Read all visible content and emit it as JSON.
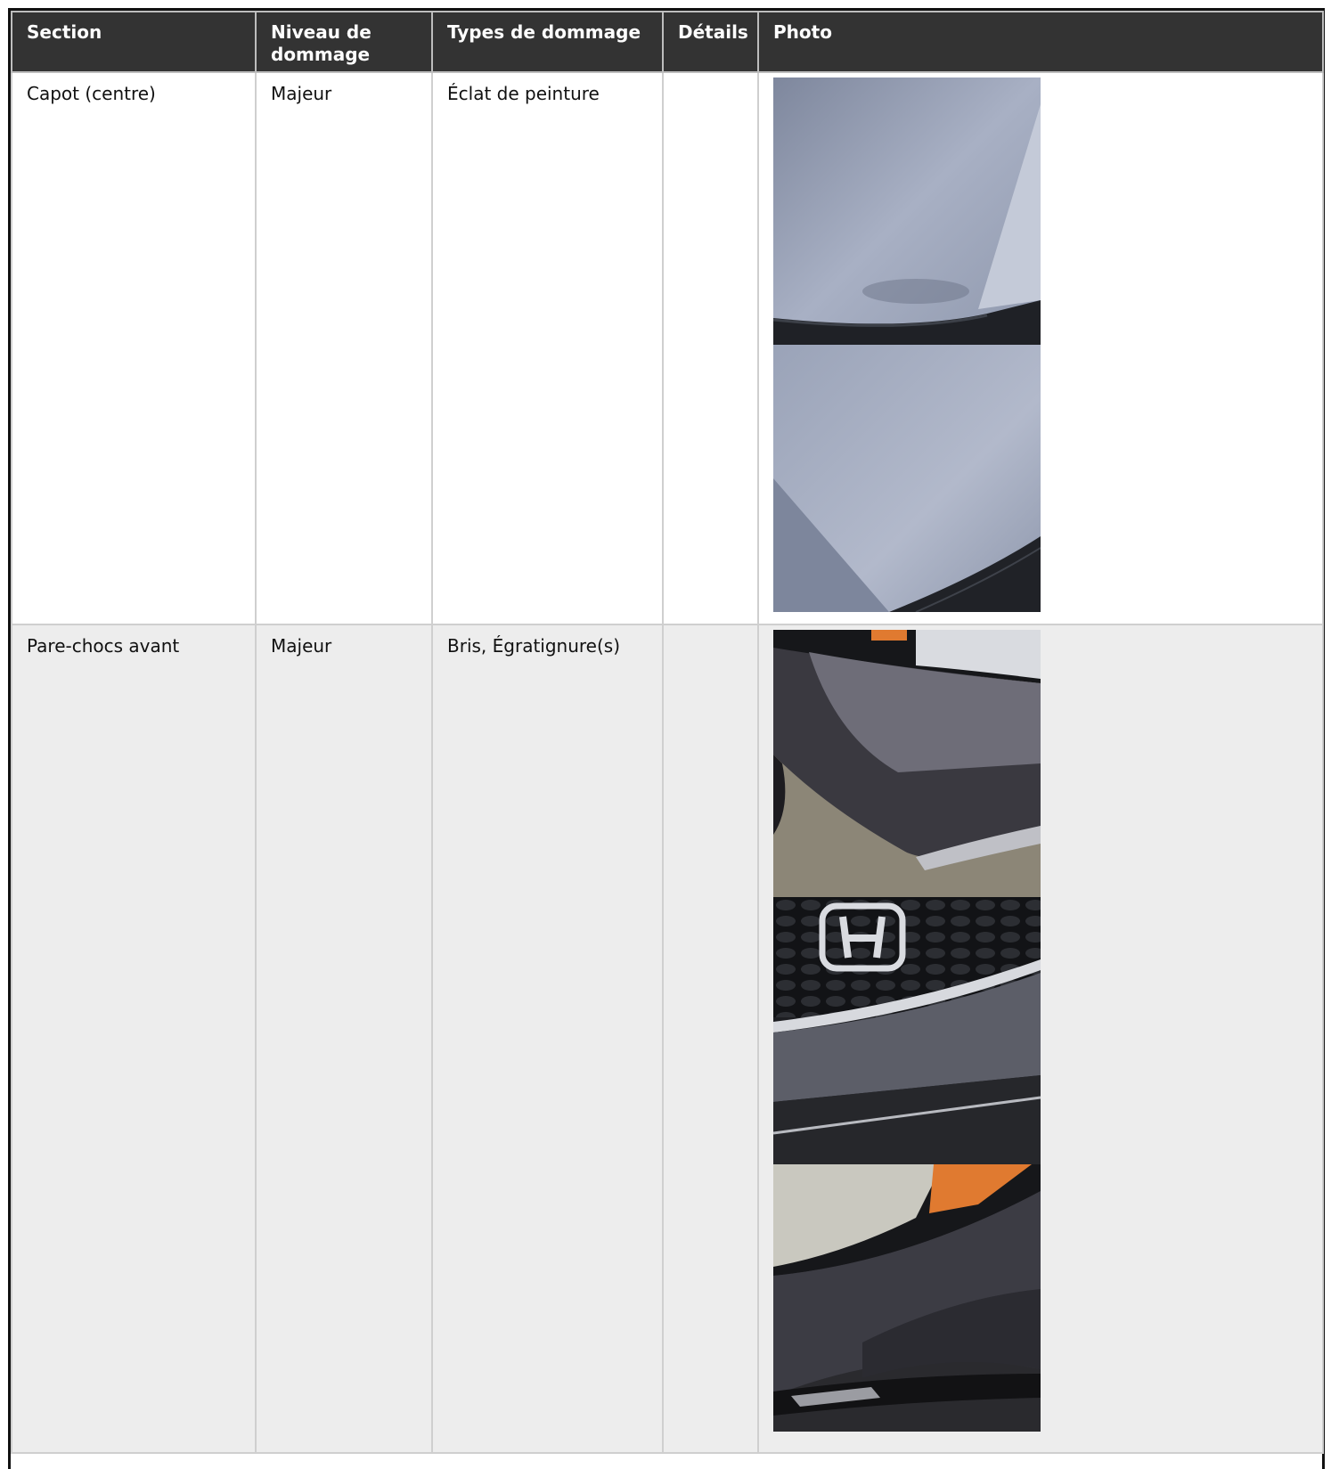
{
  "table": {
    "headers": {
      "section": "Section",
      "level": "Niveau de dommage",
      "types": "Types de dommage",
      "details": "Détails",
      "photo": "Photo"
    },
    "rows": [
      {
        "section": "Capot (centre)",
        "level": "Majeur",
        "types": "Éclat de peinture",
        "details": "",
        "photos": [
          "hood-photo",
          "hood-photo"
        ]
      },
      {
        "section": "Pare-chocs avant",
        "level": "Majeur",
        "types": "Bris, Égratignure(s)",
        "details": "",
        "photos": [
          "bumper-corner-photo",
          "grille-logo-photo",
          "headlight-bumper-photo"
        ]
      }
    ]
  },
  "colors": {
    "header_bg": "#333333",
    "header_text": "#ffffff",
    "row_alt_bg": "#ededed",
    "border": "#cfcfcf"
  }
}
